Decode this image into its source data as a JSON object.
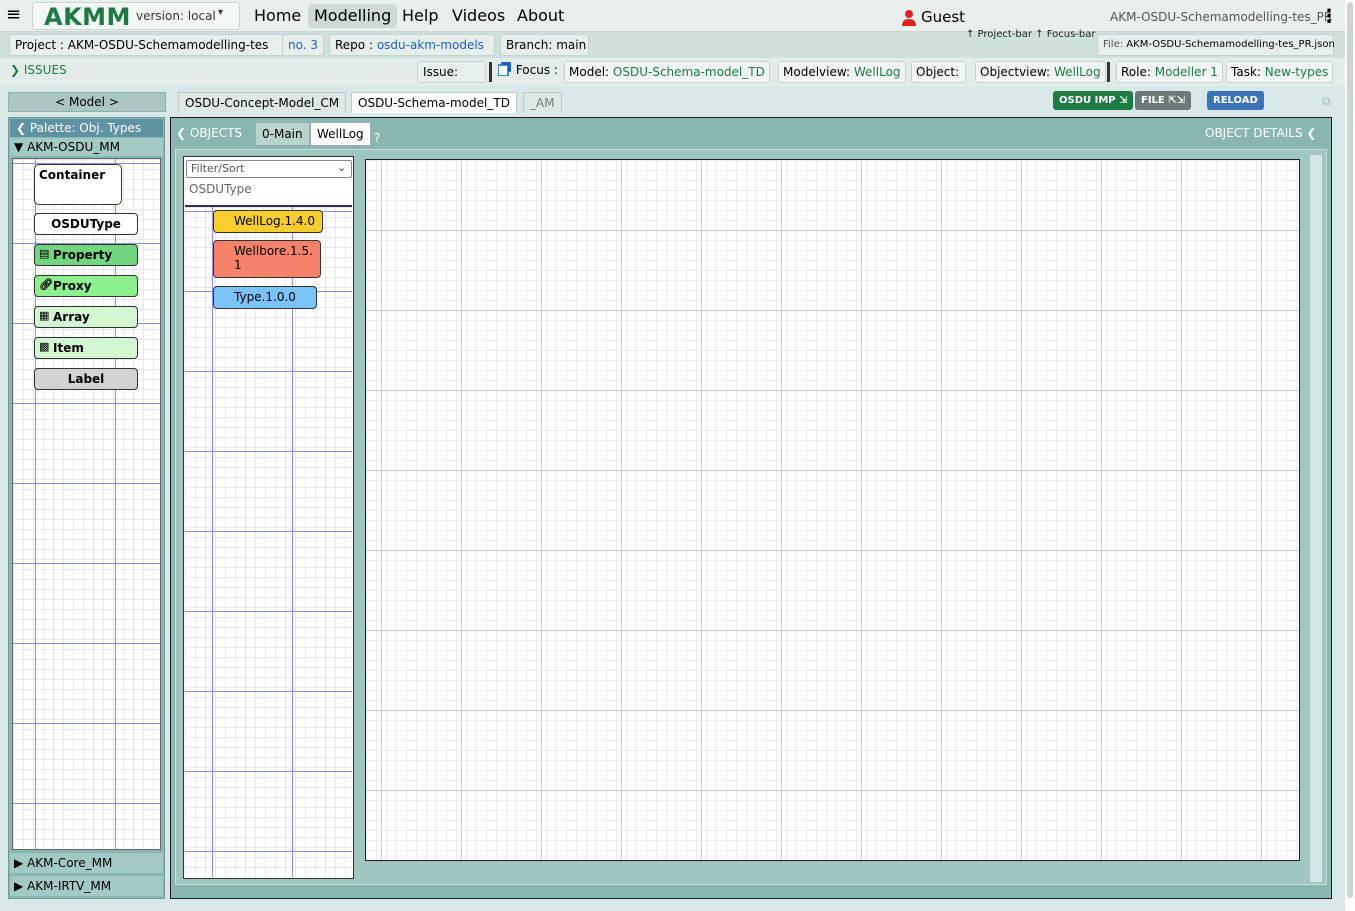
{
  "topbar": {
    "brand": "AKMM",
    "version": "version: local",
    "nav": [
      "Home",
      "Modelling",
      "Help",
      "Videos",
      "About"
    ],
    "user": "Guest",
    "model_name": "AKM-OSDU-Schemamodelling-tes_PR"
  },
  "projectbar": {
    "project_label": "Project :",
    "project_value": "AKM-OSDU-Schemamodelling-tes",
    "project_no": "no. 3",
    "repo_label": "Repo :",
    "repo_value": "osdu-akm-models",
    "branch_label": "Branch:",
    "branch_value": "main",
    "hint_project": "↑ Project-bar",
    "hint_focus": "↑ Focus-bar",
    "file_label": "File:",
    "file_value": "AKM-OSDU-Schemamodelling-tes_PR.json"
  },
  "focusbar": {
    "issues": "ISSUES",
    "issue_label": "Issue:",
    "focus_label": "Focus :",
    "model_label": "Model:",
    "model_value": "OSDU-Schema-model_TD",
    "modelview_label": "Modelview:",
    "modelview_value": "WellLog",
    "object_label": "Object:",
    "objectview_label": "Objectview:",
    "objectview_value": "WellLog",
    "role_label": "Role:",
    "role_value": "Modeller 1",
    "task_label": "Task:",
    "task_value": "New-types"
  },
  "modeltabs": {
    "model_button": "< Model >",
    "tabs": [
      "OSDU-Concept-Model_CM",
      "OSDU-Schema-model_TD",
      "_AM"
    ],
    "osdu_imp": "OSDU IMP",
    "file": "FILE",
    "reload": "RELOAD"
  },
  "palette": {
    "title": "Palette: Obj. Types",
    "metamodel": "AKM-OSDU_MM",
    "items": [
      "Container",
      "OSDUType",
      "Property",
      "Proxy",
      "Array",
      "Item",
      "Label"
    ],
    "other_metamodels": [
      "AKM-Core_MM",
      "AKM-IRTV_MM"
    ]
  },
  "workspace": {
    "objects_label": "OBJECTS",
    "view_tabs": [
      "0-Main",
      "WellLog"
    ],
    "help": "?",
    "details_label": "OBJECT DETAILS",
    "filter_placeholder": "Filter/Sort",
    "filter_type": "OSDUType",
    "objects": [
      "WellLog.1.4.0",
      "Wellbore.1.5.\n1",
      "Type.1.0.0"
    ]
  },
  "colors": {
    "brand": "#1e7a43",
    "link": "#1861c7",
    "welllog": "#f9ce2c",
    "wellbore": "#f7826a",
    "type": "#7bc2f7",
    "property": "#72d57f",
    "proxy": "#8bf08d"
  }
}
